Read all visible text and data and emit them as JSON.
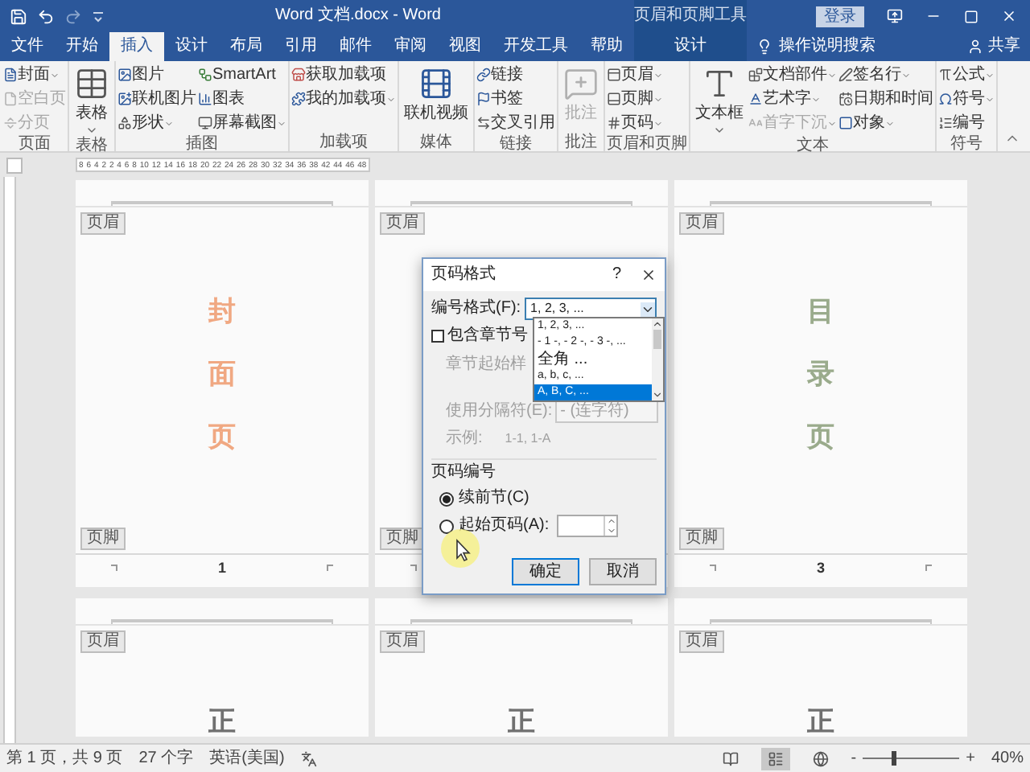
{
  "title_bar": {
    "title": "Word 文档.docx - Word",
    "context_label": "页眉和页脚工具",
    "sign_in": "登录"
  },
  "tabs": [
    {
      "label": "文件",
      "selected": false,
      "kind": "standard"
    },
    {
      "label": "开始",
      "selected": false,
      "kind": "standard"
    },
    {
      "label": "插入",
      "selected": true,
      "kind": "standard"
    },
    {
      "label": "设计",
      "selected": false,
      "kind": "standard"
    },
    {
      "label": "布局",
      "selected": false,
      "kind": "standard"
    },
    {
      "label": "引用",
      "selected": false,
      "kind": "standard"
    },
    {
      "label": "邮件",
      "selected": false,
      "kind": "standard"
    },
    {
      "label": "审阅",
      "selected": false,
      "kind": "standard"
    },
    {
      "label": "视图",
      "selected": false,
      "kind": "standard"
    },
    {
      "label": "开发工具",
      "selected": false,
      "kind": "standard"
    },
    {
      "label": "帮助",
      "selected": false,
      "kind": "standard"
    },
    {
      "label": "设计",
      "selected": false,
      "kind": "contextual"
    }
  ],
  "tell_me": "操作说明搜索",
  "share": "共享",
  "ribbon": {
    "groups": [
      {
        "label": "页面",
        "items": [
          {
            "label": "封面",
            "kind": "small",
            "dropdown": true,
            "disabled": false
          },
          {
            "label": "空白页",
            "kind": "small",
            "dropdown": false,
            "disabled": true
          },
          {
            "label": "分页",
            "kind": "small",
            "dropdown": false,
            "disabled": true
          }
        ]
      },
      {
        "label": "表格",
        "items": [
          {
            "label": "表格",
            "kind": "large",
            "dropdown": true,
            "disabled": false
          }
        ]
      },
      {
        "label": "插图",
        "items": [
          {
            "label": "图片",
            "kind": "small",
            "dropdown": false,
            "disabled": false
          },
          {
            "label": "联机图片",
            "kind": "small",
            "dropdown": false,
            "disabled": false
          },
          {
            "label": "形状",
            "kind": "small",
            "dropdown": true,
            "disabled": false
          },
          {
            "label": "SmartArt",
            "kind": "small",
            "dropdown": false,
            "disabled": false
          },
          {
            "label": "图表",
            "kind": "small",
            "dropdown": false,
            "disabled": false
          },
          {
            "label": "屏幕截图",
            "kind": "small",
            "dropdown": true,
            "disabled": false
          }
        ]
      },
      {
        "label": "加载项",
        "items": [
          {
            "label": "获取加载项",
            "kind": "small",
            "dropdown": false,
            "disabled": false
          },
          {
            "label": "我的加载项",
            "kind": "small",
            "dropdown": true,
            "disabled": false
          }
        ]
      },
      {
        "label": "媒体",
        "items": [
          {
            "label": "联机视频",
            "kind": "large",
            "dropdown": false,
            "disabled": false
          }
        ]
      },
      {
        "label": "链接",
        "items": [
          {
            "label": "链接",
            "kind": "small",
            "dropdown": false,
            "disabled": false
          },
          {
            "label": "书签",
            "kind": "small",
            "dropdown": false,
            "disabled": false
          },
          {
            "label": "交叉引用",
            "kind": "small",
            "dropdown": false,
            "disabled": false
          }
        ]
      },
      {
        "label": "批注",
        "items": [
          {
            "label": "批注",
            "kind": "large",
            "dropdown": false,
            "disabled": true
          }
        ]
      },
      {
        "label": "页眉和页脚",
        "items": [
          {
            "label": "页眉",
            "kind": "small",
            "dropdown": true,
            "disabled": false
          },
          {
            "label": "页脚",
            "kind": "small",
            "dropdown": true,
            "disabled": false
          },
          {
            "label": "页码",
            "kind": "small",
            "dropdown": true,
            "disabled": false
          }
        ]
      },
      {
        "label": "文本",
        "items": [
          {
            "label": "文本框",
            "kind": "large",
            "dropdown": true,
            "disabled": false
          },
          {
            "label": "文档部件",
            "kind": "small",
            "dropdown": true,
            "disabled": false
          },
          {
            "label": "艺术字",
            "kind": "small",
            "dropdown": true,
            "disabled": false
          },
          {
            "label": "首字下沉",
            "kind": "small",
            "dropdown": true,
            "disabled": true
          },
          {
            "label": "签名行",
            "kind": "small",
            "dropdown": true,
            "disabled": false
          },
          {
            "label": "日期和时间",
            "kind": "small",
            "dropdown": false,
            "disabled": false
          },
          {
            "label": "对象",
            "kind": "small",
            "dropdown": true,
            "disabled": false
          }
        ]
      },
      {
        "label": "符号",
        "items": [
          {
            "label": "公式",
            "kind": "small",
            "dropdown": true,
            "disabled": false
          },
          {
            "label": "符号",
            "kind": "small",
            "dropdown": true,
            "disabled": false
          },
          {
            "label": "编号",
            "kind": "small",
            "dropdown": false,
            "disabled": false
          }
        ]
      }
    ]
  },
  "ruler": {
    "labels": [
      "8",
      "6",
      "4",
      "2",
      "2",
      "4",
      "6",
      "8",
      "10",
      "12",
      "14",
      "16",
      "18",
      "20",
      "22",
      "24",
      "26",
      "28",
      "30",
      "32",
      "34",
      "36",
      "38",
      "42",
      "44",
      "46",
      "48"
    ]
  },
  "page_rows": [
    [
      {
        "header_tag": "页眉",
        "text": [
          "封",
          "面",
          "页"
        ],
        "color": "#f0a882",
        "footer_tag": "页脚",
        "number": "1"
      },
      {
        "header_tag": "页眉",
        "footer_tag": "页脚"
      },
      {
        "header_tag": "页眉",
        "text": [
          "目",
          "录",
          "页"
        ],
        "color": "#9aab8c",
        "footer_tag": "页脚",
        "number": "3"
      }
    ],
    [
      {
        "header_tag": "页眉",
        "text": [
          "正"
        ],
        "color": "#707070"
      },
      {
        "header_tag": "页眉",
        "text": [
          "正"
        ],
        "color": "#707070"
      },
      {
        "header_tag": "页眉",
        "text": [
          "正"
        ],
        "color": "#707070"
      }
    ]
  ],
  "dialog": {
    "title": "页码格式",
    "help": "?",
    "format_label": "编号格式(F):",
    "format_value": "1, 2, 3, ...",
    "format_options": [
      {
        "label": "1, 2, 3, ...",
        "selected": false
      },
      {
        "label": "- 1 -, - 2 -, - 3 -, ...",
        "selected": false
      },
      {
        "label": "全角 ...",
        "selected": false
      },
      {
        "label": "a, b, c, ...",
        "selected": false
      },
      {
        "label": "A, B, C, ...",
        "selected": true
      }
    ],
    "include_chapter": {
      "label": "包含章节号",
      "checked": false
    },
    "chapter_style_label": "章节起始样",
    "separator_label": "使用分隔符(E):",
    "separator_value": "- (连字符)",
    "example_label": "示例:",
    "example_value": "1-1, 1-A",
    "numbering_heading": "页码编号",
    "radios": [
      {
        "label": "续前节(C)",
        "selected": true
      },
      {
        "label": "起始页码(A):",
        "selected": false
      }
    ],
    "buttons": [
      "确定",
      "取消"
    ]
  },
  "status_bar": {
    "page": "第 1 页，共 9 页",
    "words": "27 个字",
    "language": "英语(美国)",
    "views": [
      {
        "selected": false
      },
      {
        "selected": true
      },
      {
        "selected": false
      }
    ],
    "zoom_out": "-",
    "zoom_in": "+",
    "zoom": {
      "level": 0.3
    },
    "zoom_label": "40%"
  }
}
